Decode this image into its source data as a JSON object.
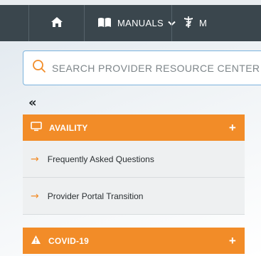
{
  "nav": {
    "manuals_label": "MANUALS",
    "third_label": "M"
  },
  "search": {
    "placeholder": "SEARCH PROVIDER RESOURCE CENTER"
  },
  "sidebar": {
    "collapse_glyph": "«",
    "sections": [
      {
        "title": "AVAILITY",
        "toggle": "+",
        "items": [
          {
            "label": "Frequently Asked Questions"
          },
          {
            "label": "Provider Portal Transition"
          }
        ]
      },
      {
        "title": "COVID-19",
        "toggle": "+"
      }
    ]
  },
  "colors": {
    "accent": "#f28c28",
    "nav_bg": "#3a464d",
    "search_border": "#7bb2dd"
  }
}
